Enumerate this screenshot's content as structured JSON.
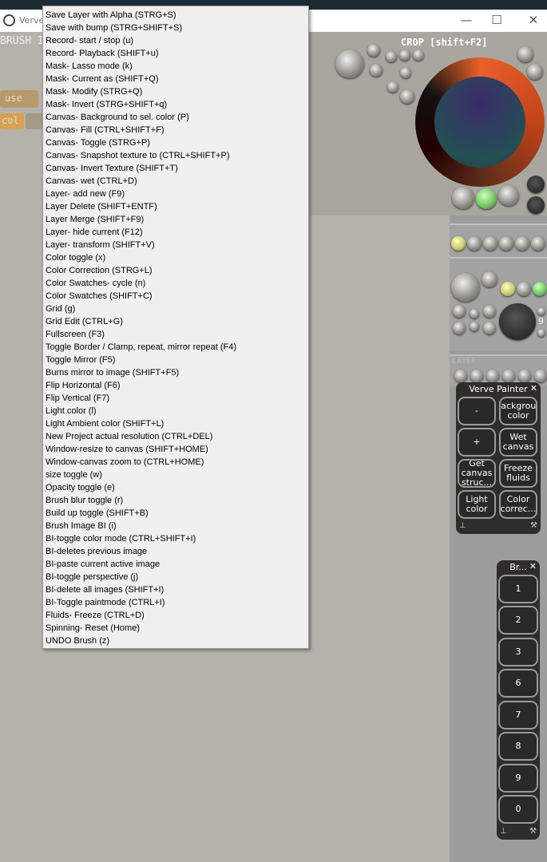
{
  "window": {
    "title": "Verve",
    "minimize": "—",
    "maximize": "☐",
    "close": "✕"
  },
  "toolbar": {
    "brush_label": "BRUSH I",
    "use_label": "use",
    "col_label": "col",
    "crop_label": "CROP [shift+F2]",
    "layer_label": "LAYER"
  },
  "menu": {
    "items": [
      "Save Layer with Alpha (STRG+S)",
      "Save with bump (STRG+SHIFT+S)",
      "Record- start / stop (u)",
      "Record- Playback  (SHIFT+u)",
      "Mask- Lasso mode (k)",
      "Mask- Current as (SHIFT+Q)",
      "Mask- Modify (STRG+Q)",
      "Mask- Invert  (STRG+SHIFT+q)",
      "Canvas- Background to sel. color (P)",
      "Canvas- Fill (CTRL+SHIFT+F)",
      "Canvas- Toggle  (STRG+P)",
      "Canvas- Snapshot texture to (CTRL+SHIFT+P)",
      "Canvas- Invert Texture (SHIFT+T)",
      "Canvas- wet (CTRL+D)",
      "Layer- add new (F9)",
      "Layer Delete (SHIFT+ENTF)",
      "Layer Merge (SHIFT+F9)",
      "Layer- hide current (F12)",
      "Layer- transform (SHIFT+V)",
      "Color toggle (x)",
      "Color Correction (STRG+L)",
      "Color Swatches- cycle (n)",
      "Color Swatches (SHIFT+C)",
      "Grid (g)",
      "Grid Edit (CTRL+G)",
      "Fullscreen (F3)",
      "Toggle Border / Clamp, repeat, mirror repeat (F4)",
      "Toggle Mirror (F5)",
      "Burns mirror to image (SHIFT+F5)",
      "Flip Horizontal (F6)",
      "Flip Vertical (F7)",
      "Light color (l)",
      "Light Ambient color (SHIFT+L)",
      "New Project actual resolution (CTRL+DEL)",
      "Window-resize to canvas (SHIFT+HOME)",
      "Window-canvas zoom to  (CTRL+HOME)",
      "size toggle (w)",
      "Opacity toggle (e)",
      "Brush blur toggle (r)",
      "Build up toggle (SHIFT+B)",
      "Brush Image BI (i)",
      "BI-toggle color mode (CTRL+SHIFT+I)",
      "BI-deletes previous image",
      "BI-paste current active image",
      "BI-toggle perspective (j)",
      "BI-delete all images (SHIFT+I)",
      "BI-Toggle paintmode (CTRL+I)",
      "Fluids- Freeze (CTRL+D)",
      "Spinning- Reset (Home)",
      "UNDO Brush (z)"
    ]
  },
  "verve_panel": {
    "title": "Verve Painter",
    "close": "✕",
    "buttons": [
      "-",
      "Backgroun\ncolor",
      "+",
      "Wet\ncanvas",
      "Get\ncanvas\nstruc...",
      "Freeze\nfluids",
      "Light\ncolor",
      "Color\ncorrec..."
    ],
    "pin": "📌",
    "wrench": "🔧"
  },
  "brush_panel": {
    "title": "Br...",
    "close": "✕",
    "buttons": [
      "1",
      "2",
      "3",
      "6",
      "7",
      "8",
      "9",
      "0"
    ],
    "pin": "📌",
    "wrench": "🔧"
  },
  "side_label": "9"
}
